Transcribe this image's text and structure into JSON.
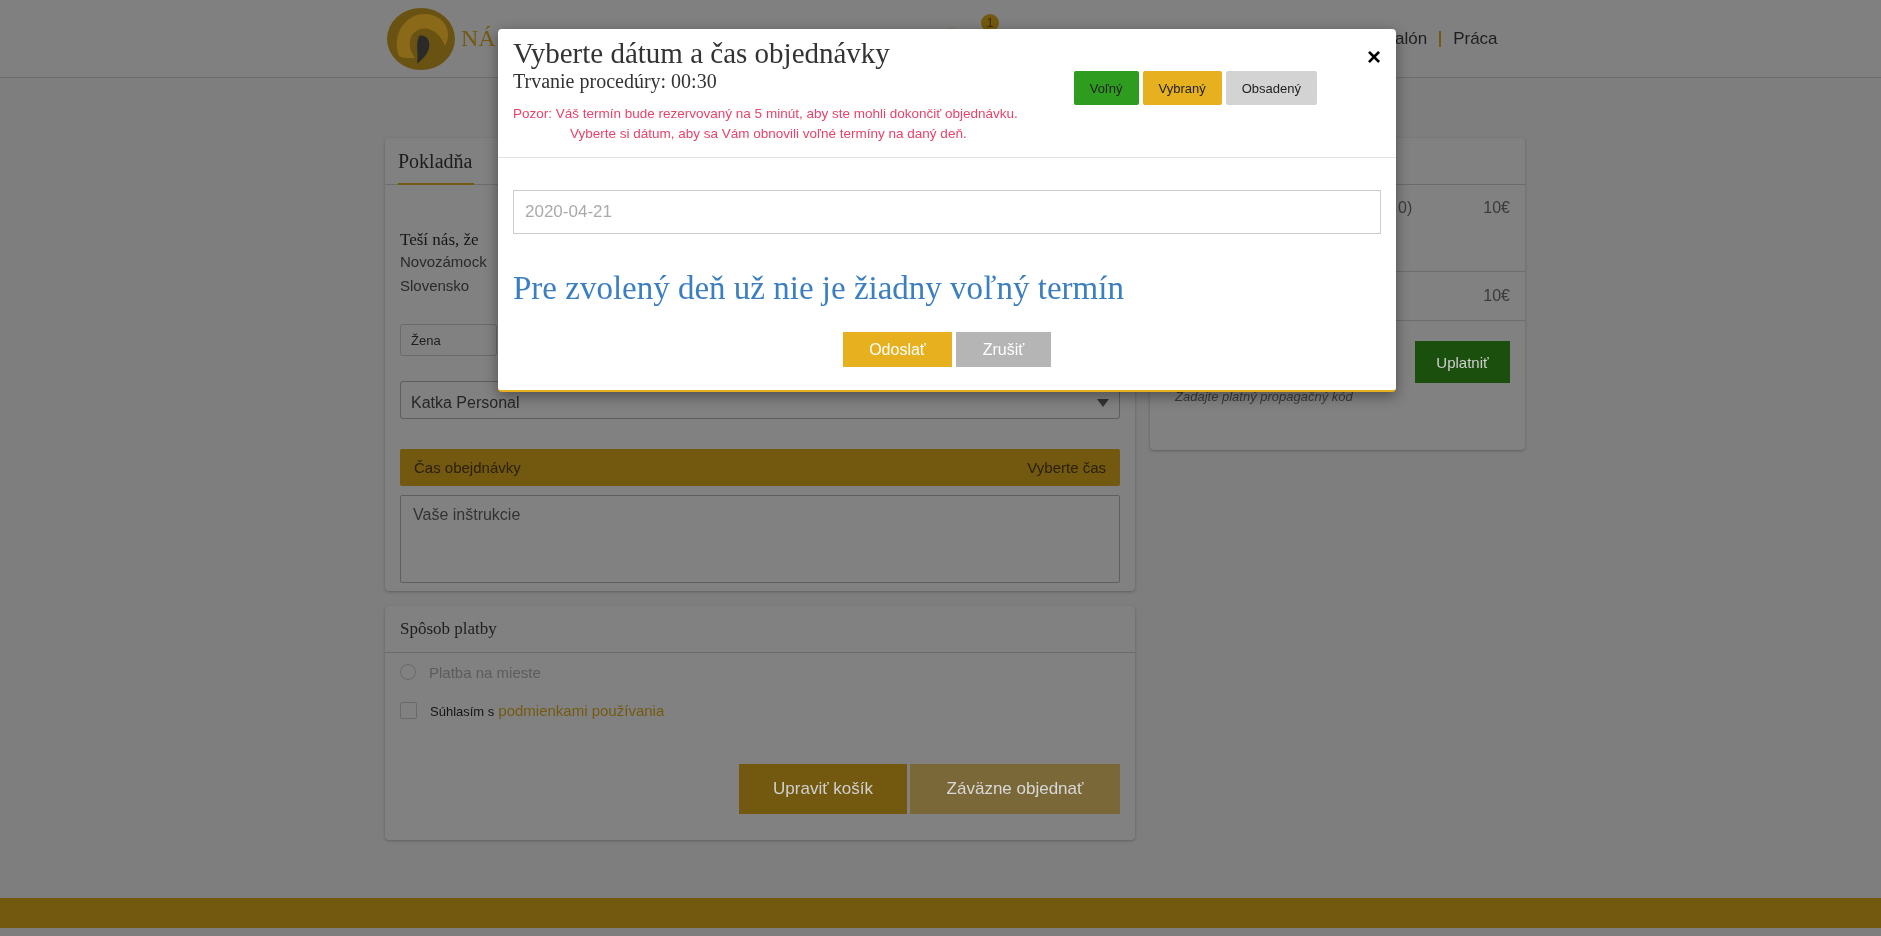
{
  "header": {
    "logo_text": "NÁ",
    "cart_count": "1",
    "nav": [
      "alón",
      "Práca"
    ]
  },
  "checkout": {
    "title": "Pokladňa",
    "greeting": "Teší nás, že",
    "address": [
      "Novozámock",
      "Slovensko"
    ],
    "gender_select": "Žena",
    "staff_select": "Katka Personal",
    "time_bar": {
      "label": "Čas obejdnávky",
      "action": "Vyberte čas"
    },
    "instructions": {
      "placeholder": "Vaše inštrukcie"
    }
  },
  "payment": {
    "title": "Spôsob platby",
    "options": [
      {
        "kind": "radio",
        "label": "Platba na mieste",
        "selected": false
      },
      {
        "kind": "checkbox",
        "label": "Súhlasím s",
        "link": "podmienkami používania",
        "checked": false
      }
    ],
    "buttons": [
      {
        "label": "Upraviť košík",
        "disabled": false
      },
      {
        "label": "Záväzne objednať",
        "disabled": true
      }
    ]
  },
  "summary": {
    "item": {
      "name": "0)",
      "price": "10€"
    },
    "total": "10€",
    "apply_button": "Uplatniť",
    "promo_hint": "Zadajte platný propagačný kód"
  },
  "modal": {
    "title": "Vyberte dátum a čas objednávky",
    "duration": "Trvanie procedúry: 00:30",
    "notice": [
      "Pozor: Váš termín bude rezervovaný na 5 minút, aby ste mohli dokončiť objednávku.",
      "Vyberte si dátum, aby sa Vám obnovili voľné termíny na daný deň."
    ],
    "legend": [
      {
        "label": "Voľný",
        "color": "#2e9c1e"
      },
      {
        "label": "Vybraný",
        "color": "#e6b01f"
      },
      {
        "label": "Obsadený",
        "color": "#d3d3d3"
      }
    ],
    "close": "×",
    "date_field": {
      "value": "2020-04-21"
    },
    "message": "Pre zvolený deň už nie je žiadny voľný termín",
    "buttons": [
      {
        "label": "Odoslať",
        "kind": "primary"
      },
      {
        "label": "Zrušiť",
        "kind": "secondary"
      }
    ]
  }
}
